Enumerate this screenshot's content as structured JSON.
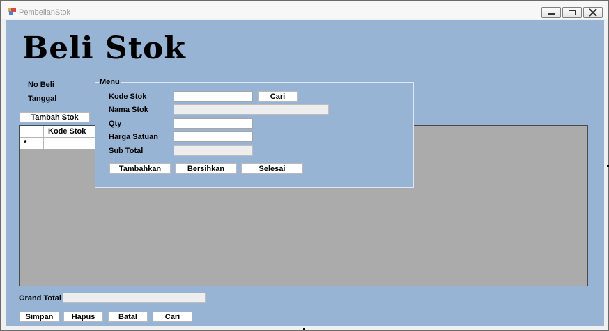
{
  "window": {
    "title": "PembelianStok",
    "app_icon": "form-app-icon",
    "controls": [
      "minimize-icon",
      "maximize-icon",
      "close-icon"
    ]
  },
  "heading": "Beli Stok",
  "fields": {
    "no_beli_label": "No Beli",
    "tanggal_label": "Tanggal"
  },
  "tambah_stok_button": "Tambah Stok",
  "grid": {
    "columns": [
      "Kode Stok"
    ],
    "new_row_marker": "*"
  },
  "menu": {
    "title": "Menu",
    "kode_stok_label": "Kode Stok",
    "kode_stok_value": "",
    "cari_button": "Cari",
    "nama_stok_label": "Nama Stok",
    "nama_stok_value": "",
    "qty_label": "Qty",
    "qty_value": "",
    "harga_satuan_label": "Harga Satuan",
    "harga_satuan_value": "",
    "sub_total_label": "Sub Total",
    "sub_total_value": "",
    "buttons": {
      "tambahkan": "Tambahkan",
      "bersihkan": "Bersihkan",
      "selesai": "Selesai"
    }
  },
  "grand_total": {
    "label": "Grand Total",
    "value": ""
  },
  "bottom_buttons": {
    "simpan": "Simpan",
    "hapus": "Hapus",
    "batal": "Batal",
    "cari": "Cari"
  },
  "colors": {
    "form_background": "#98b4d4",
    "grid_background": "#ababab",
    "title_text": "#9a9a9a"
  }
}
